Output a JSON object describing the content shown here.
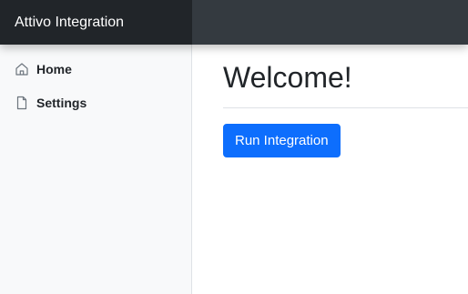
{
  "navbar": {
    "brand": "Attivo Integration"
  },
  "sidebar": {
    "items": [
      {
        "label": "Home",
        "icon": "home-icon"
      },
      {
        "label": "Settings",
        "icon": "file-icon"
      }
    ]
  },
  "main": {
    "title": "Welcome!",
    "run_button_label": "Run Integration"
  },
  "colors": {
    "navbar_bg": "#343a40",
    "brand_bg": "#212529",
    "sidebar_bg": "#f8f9fa",
    "primary": "#0d6efd"
  }
}
